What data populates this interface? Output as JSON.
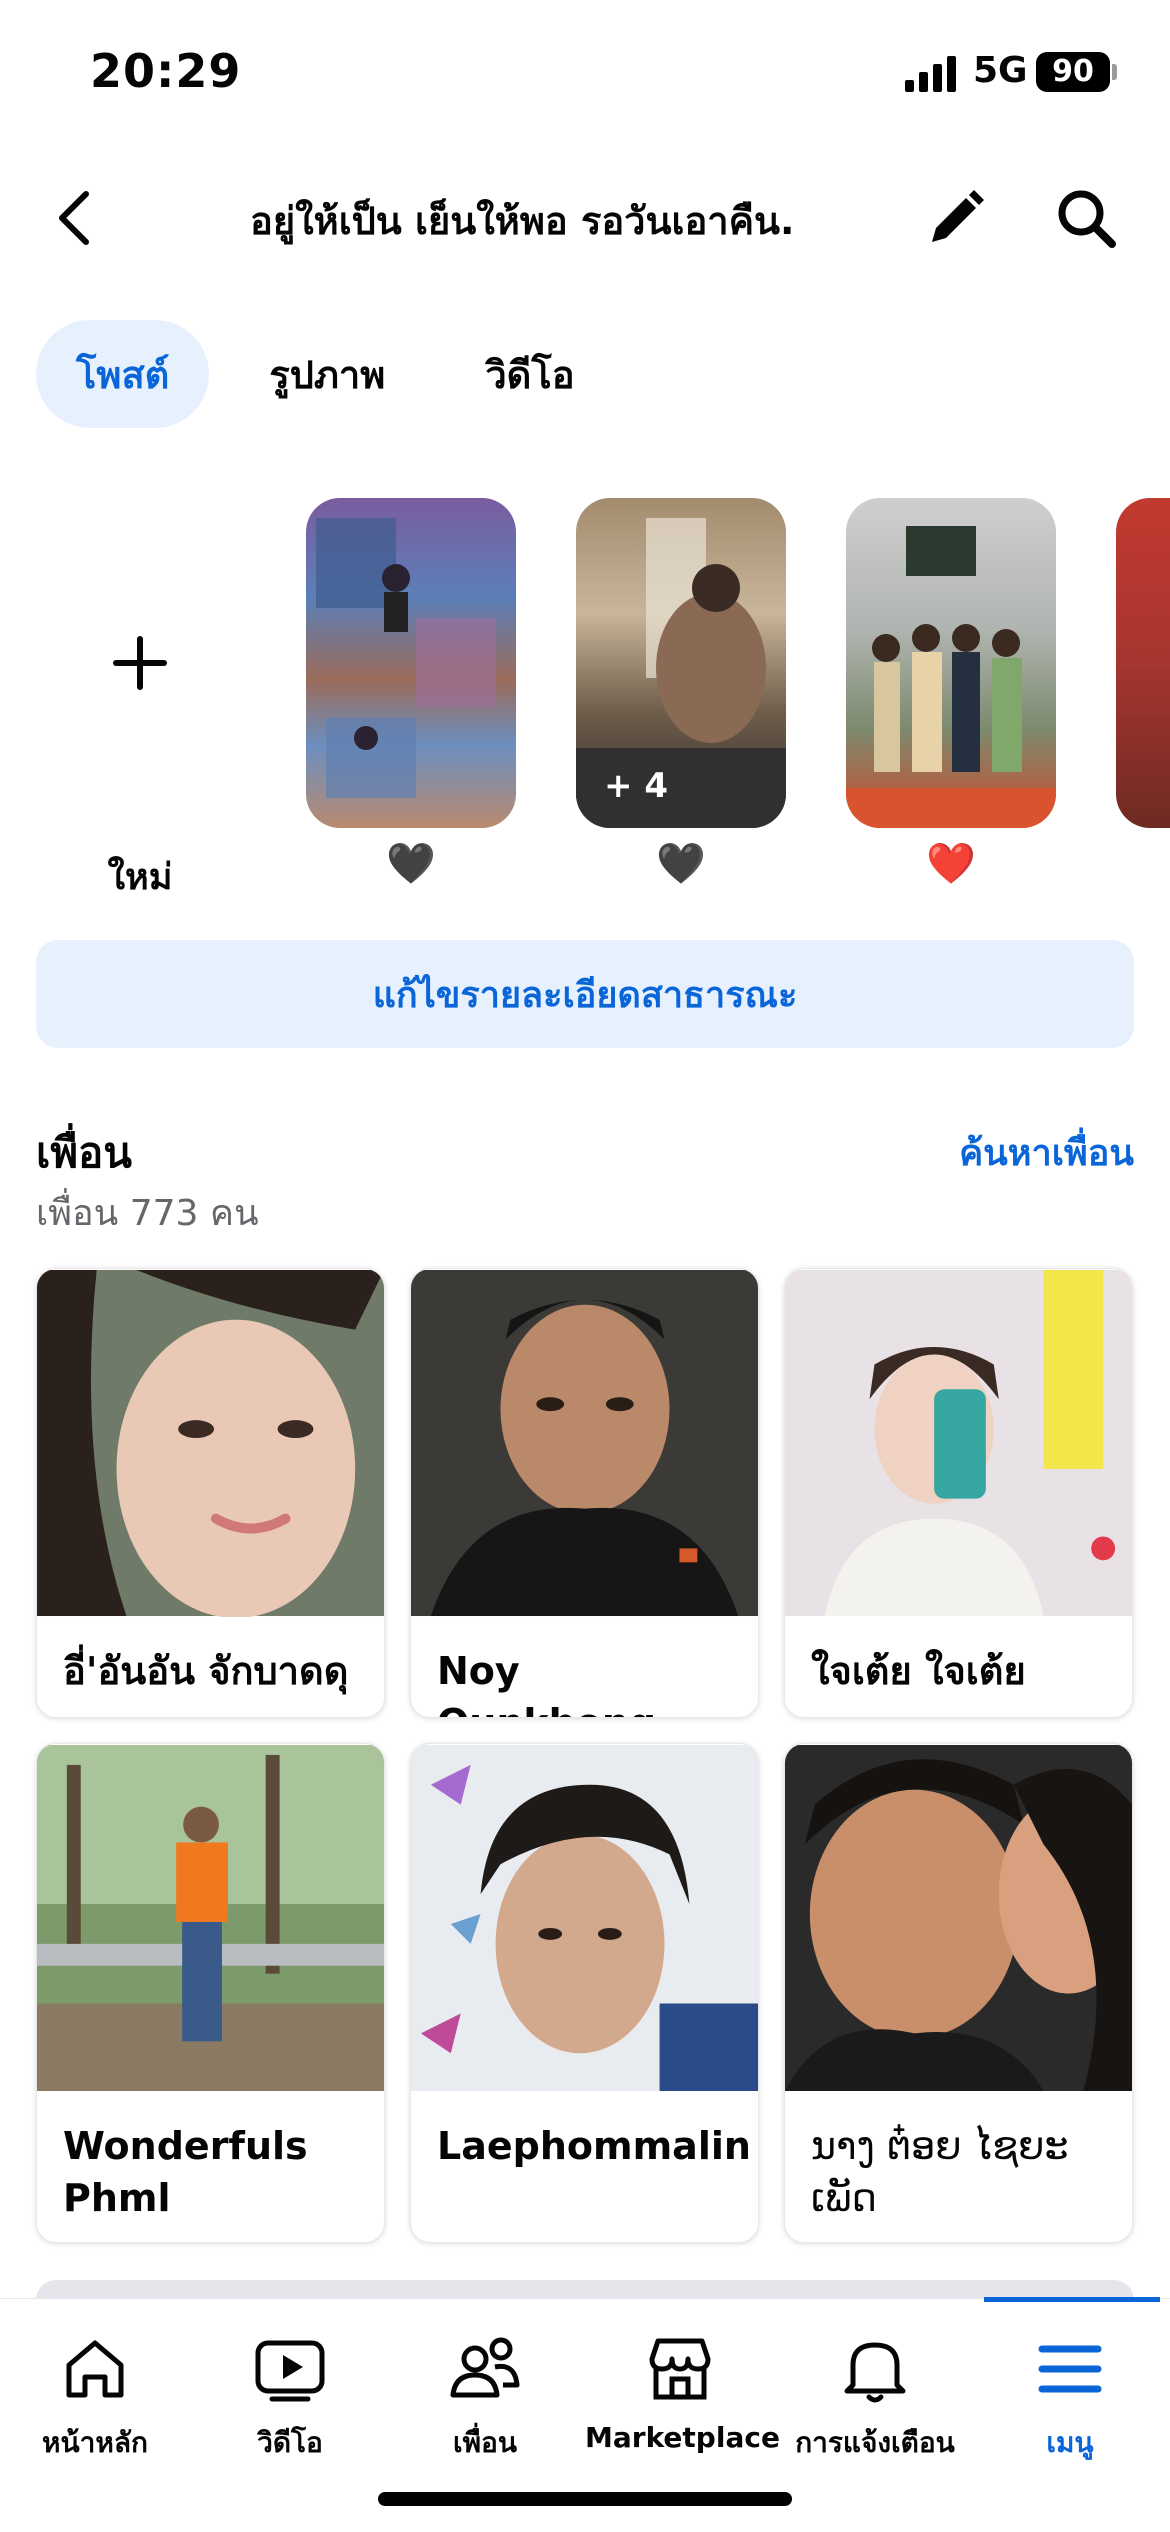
{
  "status_bar": {
    "time": "20:29",
    "network": "5G",
    "battery": "90"
  },
  "header": {
    "profile_name": "อยู่ให้เป็น เย็นให้พอ รอวันเอาคืน.",
    "back_icon": "chevron-left-icon",
    "edit_icon": "pencil-icon",
    "search_icon": "search-icon"
  },
  "tabs": [
    {
      "label": "โพสต์",
      "active": true
    },
    {
      "label": "รูปภาพ",
      "active": false
    },
    {
      "label": "วิดีโอ",
      "active": false
    }
  ],
  "stories": {
    "new_label": "ใหม่",
    "items": [
      {
        "emoji": "🖤",
        "more": ""
      },
      {
        "emoji": "🖤",
        "more": "+ 4"
      },
      {
        "emoji": "❤️",
        "more": ""
      }
    ]
  },
  "edit_details_label": "แก้ไขรายละเอียดสาธารณะ",
  "friends": {
    "title": "เพื่อน",
    "count_text": "เพื่อน 773 คน",
    "find_label": "ค้นหาเพื่อน",
    "cards": [
      {
        "name": "อี่'อันอัน จักบาดดุ"
      },
      {
        "name": "Noy Ounkhong"
      },
      {
        "name": "ใจเต้ย ใจเต้ย"
      },
      {
        "name": "Wonderfuls Phml"
      },
      {
        "name": "Laephommalin"
      },
      {
        "name": "ນາງ ຕ໋ອຍ ໄຊຍະເພັດ"
      }
    ]
  },
  "bottom_nav": [
    {
      "label": "หน้าหลัก",
      "icon": "home-icon",
      "active": false
    },
    {
      "label": "วิดีโอ",
      "icon": "video-icon",
      "active": false
    },
    {
      "label": "เพื่อน",
      "icon": "friends-icon",
      "active": false
    },
    {
      "label": "Marketplace",
      "icon": "marketplace-icon",
      "active": false
    },
    {
      "label": "การแจ้งเตือน",
      "icon": "bell-icon",
      "active": false
    },
    {
      "label": "เมนู",
      "icon": "menu-icon",
      "active": true
    }
  ],
  "colors": {
    "accent": "#0a66d8",
    "accent_bg": "#e7f1fd",
    "muted": "#65676b"
  }
}
